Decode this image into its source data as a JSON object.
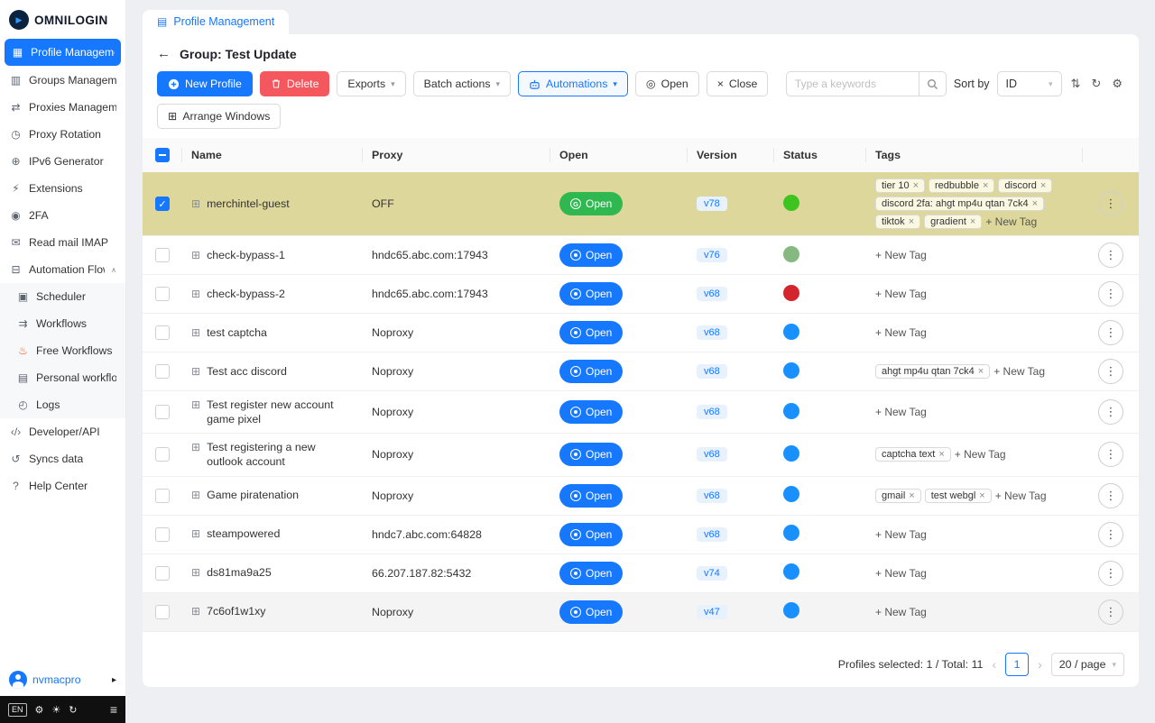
{
  "app": {
    "name": "OMNILOGIN"
  },
  "colors": {
    "accent": "#1677ff",
    "danger": "#f5575f",
    "green-open": "#2eb84f",
    "selected-row": "#ded79c"
  },
  "sidebar": {
    "items": [
      {
        "label": "Profile Management",
        "icon": "profile-icon",
        "active": true
      },
      {
        "label": "Groups Managem...",
        "icon": "groups-icon"
      },
      {
        "label": "Proxies Managem...",
        "icon": "proxies-icon"
      },
      {
        "label": "Proxy Rotation",
        "icon": "rotation-icon"
      },
      {
        "label": "IPv6 Generator",
        "icon": "ipv6-icon"
      },
      {
        "label": "Extensions",
        "icon": "extensions-icon"
      },
      {
        "label": "2FA",
        "icon": "2fa-icon"
      },
      {
        "label": "Read mail IMAP",
        "icon": "mail-icon"
      },
      {
        "label": "Automation Flow",
        "icon": "flow-icon",
        "expandable": true,
        "expanded": true,
        "children": [
          {
            "label": "Scheduler",
            "icon": "scheduler-icon"
          },
          {
            "label": "Workflows",
            "icon": "workflows-icon"
          },
          {
            "label": "Free Workflows",
            "icon": "flame-icon",
            "icon_color": "#fa541c"
          },
          {
            "label": "Personal workflo...",
            "icon": "personal-icon"
          },
          {
            "label": "Logs",
            "icon": "logs-icon"
          }
        ]
      },
      {
        "label": "Developer/API",
        "icon": "developer-icon"
      },
      {
        "label": "Syncs data",
        "icon": "sync-icon"
      },
      {
        "label": "Help Center",
        "icon": "help-icon"
      }
    ],
    "user": {
      "name": "nvmacpro"
    },
    "statusbar": {
      "lang": "EN"
    }
  },
  "tabs": [
    {
      "label": "Profile Management",
      "active": true
    }
  ],
  "header": {
    "title": "Group: Test Update"
  },
  "toolbar": {
    "new_profile": "New Profile",
    "delete": "Delete",
    "exports": "Exports",
    "batch_actions": "Batch actions",
    "automations": "Automations",
    "open": "Open",
    "close": "Close",
    "arrange_windows": "Arrange Windows",
    "search": {
      "placeholder": "Type a keywords"
    },
    "sort_by_label": "Sort by",
    "sort_field": "ID"
  },
  "table": {
    "columns": [
      "Name",
      "Proxy",
      "Open",
      "Version",
      "Status",
      "Tags"
    ],
    "open_label": "Open",
    "new_tag_label": "+ New Tag",
    "status_colors": {
      "green": "#3ec421",
      "sage": "#85b97f",
      "red": "#d4252c",
      "blue": "#1890ff"
    },
    "rows": [
      {
        "name": "merchintel-guest",
        "proxy": "OFF",
        "version": "v78",
        "status": "green",
        "selected": true,
        "open_style": "green",
        "tags": [
          "tier 10",
          "redbubble",
          "discord",
          "discord 2fa: ahgt mp4u qtan 7ck4",
          "tiktok",
          "gradient"
        ]
      },
      {
        "name": "check-bypass-1",
        "proxy": "hndc65.abc.com:17943",
        "version": "v76",
        "status": "sage",
        "tags": []
      },
      {
        "name": "check-bypass-2",
        "proxy": "hndc65.abc.com:17943",
        "version": "v68",
        "status": "red",
        "tags": []
      },
      {
        "name": "test captcha",
        "proxy": "Noproxy",
        "version": "v68",
        "status": "blue",
        "tags": []
      },
      {
        "name": "Test acc discord",
        "proxy": "Noproxy",
        "version": "v68",
        "status": "blue",
        "tags": [
          "ahgt mp4u qtan 7ck4"
        ]
      },
      {
        "name": "Test register new account game pixel",
        "proxy": "Noproxy",
        "version": "v68",
        "status": "blue",
        "tags": []
      },
      {
        "name": "Test registering a new outlook account",
        "proxy": "Noproxy",
        "version": "v68",
        "status": "blue",
        "tags": [
          "captcha text"
        ]
      },
      {
        "name": "Game piratenation",
        "proxy": "Noproxy",
        "version": "v68",
        "status": "blue",
        "tags": [
          "gmail",
          "test webgl"
        ]
      },
      {
        "name": "steampowered",
        "proxy": "hndc7.abc.com:64828",
        "version": "v68",
        "status": "blue",
        "tags": []
      },
      {
        "name": "ds81ma9a25",
        "proxy": "66.207.187.82:5432",
        "version": "v74",
        "status": "blue",
        "tags": []
      },
      {
        "name": "7c6of1w1xy",
        "proxy": "Noproxy",
        "version": "v47",
        "status": "blue",
        "tags": [],
        "shaded": true
      }
    ]
  },
  "footer": {
    "summary": "Profiles selected: 1 / Total: 11",
    "page": "1",
    "page_size": "20 / page"
  }
}
